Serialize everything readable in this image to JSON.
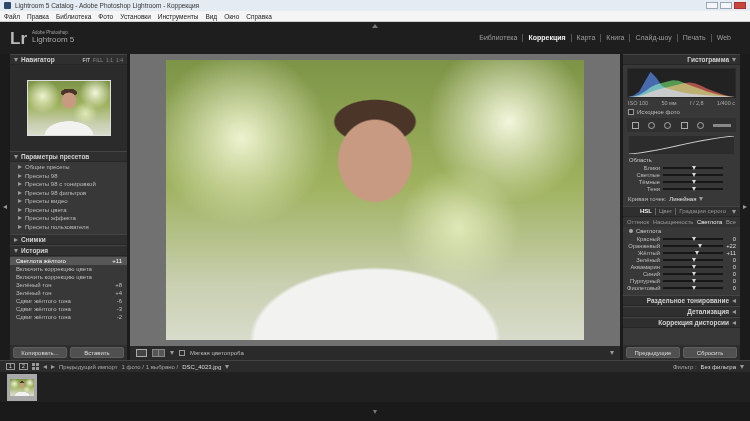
{
  "window": {
    "title": "Lightroom 5 Catalog - Adobe Photoshop Lightroom - Коррекция"
  },
  "menu": [
    "Файл",
    "Правка",
    "Библиотека",
    "Фото",
    "Установки",
    "Инструменты",
    "Вид",
    "Окно",
    "Справка"
  ],
  "header": {
    "logo": "Lr",
    "brand_top": "Adobe Photoshop",
    "brand": "Lightroom 5"
  },
  "modules": [
    {
      "label": "Библиотека",
      "selected": false
    },
    {
      "label": "Коррекция",
      "selected": true
    },
    {
      "label": "Карта",
      "selected": false
    },
    {
      "label": "Книга",
      "selected": false
    },
    {
      "label": "Слайд-шоу",
      "selected": false
    },
    {
      "label": "Печать",
      "selected": false
    },
    {
      "label": "Web",
      "selected": false
    }
  ],
  "navigator": {
    "title": "Навигатор",
    "expanded": true,
    "zoom": [
      {
        "label": "FIT",
        "selected": true
      },
      {
        "label": "FILL",
        "selected": false
      },
      {
        "label": "1:1",
        "selected": false
      },
      {
        "label": "1:4",
        "selected": false
      }
    ]
  },
  "presets": {
    "title": "Параметры пресетов",
    "expanded": true,
    "items": [
      "Общие пресеты",
      "Пресеты 98",
      "Пресеты 98 с тонировкой",
      "Пресеты 98 фильтров",
      "Пресеты видео",
      "Пресеты цвета",
      "Пресеты эффекта",
      "Пресеты пользователя"
    ]
  },
  "snapshots": {
    "title": "Снимки",
    "expanded": false
  },
  "history": {
    "title": "История",
    "expanded": true,
    "items": [
      {
        "label": "Светлота жёлтого",
        "value": "+11",
        "selected": true
      },
      {
        "label": "Включить коррекцию цвета",
        "value": "",
        "selected": false
      },
      {
        "label": "Включить коррекцию цвета",
        "value": "",
        "selected": false
      },
      {
        "label": "Зелёный тон",
        "value": "+8",
        "selected": false
      },
      {
        "label": "Зелёный тон",
        "value": "+4",
        "selected": false
      },
      {
        "label": "Сдвиг жёлтого тона",
        "value": "-6",
        "selected": false
      },
      {
        "label": "Сдвиг жёлтого тона",
        "value": "-3",
        "selected": false
      },
      {
        "label": "Сдвиг жёлтого тона",
        "value": "-2",
        "selected": false
      }
    ]
  },
  "left_buttons": [
    "Копировать...",
    "Вставить"
  ],
  "toolbar": {
    "soft_proof": {
      "label": "Мягкая цветопроба",
      "checked": false
    }
  },
  "histogram": {
    "title": "Гистограмма",
    "expanded": true,
    "series": [
      {
        "name": "blue",
        "color": "#3a6fd8",
        "values": [
          0,
          5,
          20,
          55,
          90,
          70,
          40,
          30,
          25,
          20,
          15,
          12,
          10,
          8,
          6,
          5,
          4,
          3,
          2,
          0
        ]
      },
      {
        "name": "green",
        "color": "#4fb84a",
        "values": [
          0,
          2,
          8,
          20,
          35,
          45,
          50,
          55,
          60,
          58,
          50,
          42,
          35,
          28,
          20,
          14,
          9,
          5,
          2,
          0
        ]
      },
      {
        "name": "red",
        "color": "#d24a3c",
        "values": [
          0,
          1,
          4,
          10,
          18,
          25,
          30,
          35,
          40,
          45,
          50,
          52,
          48,
          40,
          30,
          22,
          15,
          8,
          3,
          0
        ]
      }
    ],
    "readings": [
      "ISO 100",
      "50 мм",
      "f / 2,8",
      "1/400 с"
    ],
    "original_photo": {
      "label": "Исходное фото",
      "checked": false
    }
  },
  "tone": {
    "region_label": "Область",
    "sliders": [
      {
        "label": "Блики",
        "level": 0.5
      },
      {
        "label": "Светлые",
        "level": 0.5
      },
      {
        "label": "Тёмные",
        "level": 0.5
      },
      {
        "label": "Тени",
        "level": 0.5
      }
    ],
    "point_curve_label": "Кривая точек:",
    "point_curve_value": "Линейная"
  },
  "hsl": {
    "expanded": true,
    "tabs": [
      {
        "label": "HSL",
        "selected": true
      },
      {
        "label": "Цвет",
        "selected": false
      },
      {
        "label": "Градации серого",
        "selected": false
      }
    ],
    "subtabs": [
      {
        "label": "Оттенок",
        "selected": false
      },
      {
        "label": "Насыщенность",
        "selected": false
      },
      {
        "label": "Светлота",
        "selected": true
      },
      {
        "label": "Все",
        "selected": false
      }
    ],
    "section_label": "Светлота",
    "sliders": [
      {
        "label": "Красный",
        "level": 0.5,
        "reading": "0"
      },
      {
        "label": "Оранжевый",
        "level": 0.61,
        "reading": "+22"
      },
      {
        "label": "Жёлтый",
        "level": 0.555,
        "reading": "+11"
      },
      {
        "label": "Зелёный",
        "level": 0.5,
        "reading": "0"
      },
      {
        "label": "Аквамарин",
        "level": 0.5,
        "reading": "0"
      },
      {
        "label": "Синий",
        "level": 0.5,
        "reading": "0"
      },
      {
        "label": "Пурпурный",
        "level": 0.5,
        "reading": "0"
      },
      {
        "label": "Фиолетовый",
        "level": 0.5,
        "reading": "0"
      }
    ]
  },
  "collapsed_panels": [
    {
      "label": "Раздельное тонирование",
      "expanded": false
    },
    {
      "label": "Детализация",
      "expanded": false
    },
    {
      "label": "Коррекция дисторсии",
      "expanded": false
    }
  ],
  "right_buttons": [
    "Предыдущие",
    "Сбросить"
  ],
  "filmstrip": {
    "monitors": [
      "1",
      "2"
    ],
    "source": "Предыдущий импорт",
    "info": "1 фото / 1 выбрано /",
    "file": "DSC_4023.jpg",
    "filter_label": "Фильтр :",
    "filter_value": "Без фильтра",
    "thumbnails": [
      {
        "selected": true
      }
    ]
  }
}
